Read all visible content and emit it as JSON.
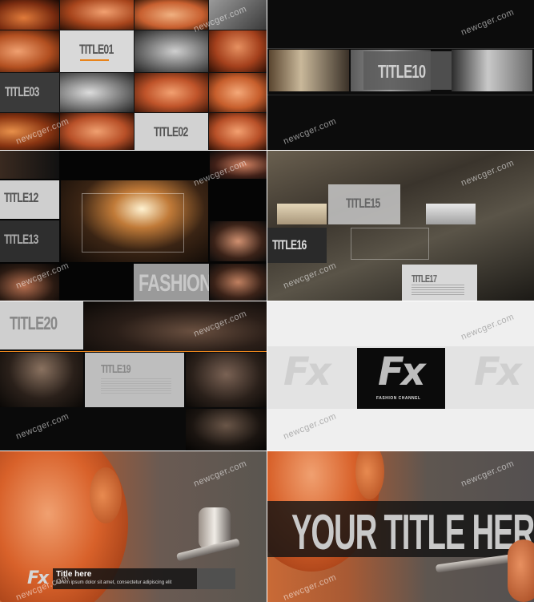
{
  "watermark": "newcger.com",
  "panels": {
    "p1": {
      "title01": "TITLE01",
      "title02": "TITLE02",
      "title03": "TITLE03"
    },
    "p2": {
      "title10": "TITLE10"
    },
    "p3": {
      "title12": "TITLE12",
      "title13": "TITLE13",
      "fashion": "FASHION"
    },
    "p4": {
      "title15": "TITLE15",
      "title16": "TITLE16",
      "title17": "TITLE17"
    },
    "p5": {
      "title19": "TITLE19",
      "title20": "TITLE20"
    },
    "p6": {
      "logo": "Fx",
      "channel": "FASHION CHANNEL"
    },
    "p7": {
      "logo": "Fx",
      "title": "Title here",
      "body": "Lorem ipsum dolor sit amet, consectetur adipiscing elit"
    },
    "p8": {
      "headline": "YOUR TITLE HERE"
    }
  },
  "colors": {
    "accent_orange": "#e8841c",
    "skin_orange": "#d8612a",
    "dark": "#0b0b0b",
    "light_gray": "#e6e6e6"
  }
}
